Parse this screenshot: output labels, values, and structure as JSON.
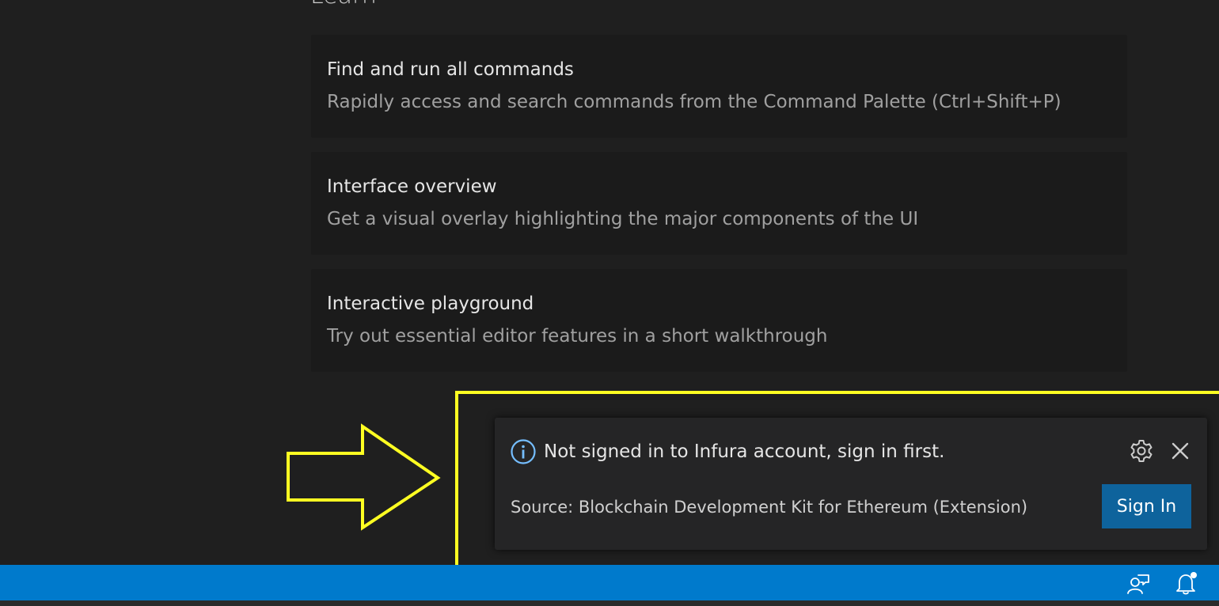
{
  "section": {
    "heading": "Learn"
  },
  "cards": [
    {
      "title": "Find and run all commands",
      "description": "Rapidly access and search commands from the Command Palette (Ctrl+Shift+P)"
    },
    {
      "title": "Interface overview",
      "description": "Get a visual overlay highlighting the major components of the UI"
    },
    {
      "title": "Interactive playground",
      "description": "Try out essential editor features in a short walkthrough"
    }
  ],
  "notification": {
    "icon": "info-icon",
    "message": "Not signed in to Infura account, sign in first.",
    "source": "Source: Blockchain Development Kit for Ethereum (Extension)",
    "action_label": "Sign In",
    "settings_icon": "gear-icon",
    "close_icon": "close-icon"
  },
  "annotation": {
    "arrow_color": "#ffff22",
    "box_color": "#ffff22"
  },
  "status_bar": {
    "color": "#007acc",
    "icons": [
      "feedback-icon",
      "bell-icon"
    ]
  }
}
